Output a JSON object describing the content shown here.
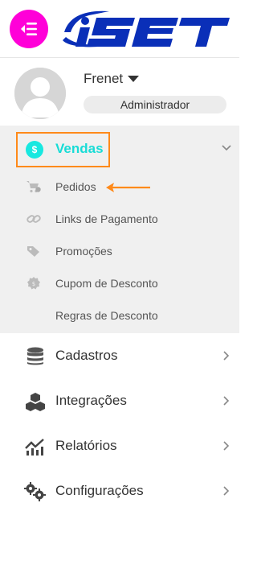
{
  "header": {
    "menu_icon": "menu-collapse-icon",
    "logo_text": "iSET",
    "brand_colors": {
      "menu_button": "#ff00d8",
      "logo_blue": "#0a2fb8"
    }
  },
  "user": {
    "name": "Frenet",
    "role": "Administrador",
    "dropdown_icon": "caret-down-icon"
  },
  "sidebar": {
    "active_color": "#18dcd6",
    "vendas": {
      "label": "Vendas",
      "icon": "dollar-circle-icon",
      "expanded": true,
      "items": [
        {
          "label": "Pedidos",
          "icon": "cart-icon"
        },
        {
          "label": "Links de Pagamento",
          "icon": "link-icon"
        },
        {
          "label": "Promoções",
          "icon": "tag-icon"
        },
        {
          "label": "Cupom de Desconto",
          "icon": "coupon-icon"
        },
        {
          "label": "Regras de Desconto",
          "icon": ""
        }
      ]
    },
    "main_items": [
      {
        "label": "Cadastros",
        "icon": "database-icon"
      },
      {
        "label": "Integrações",
        "icon": "cubes-icon"
      },
      {
        "label": "Relatórios",
        "icon": "chart-icon"
      },
      {
        "label": "Configurações",
        "icon": "gears-icon"
      }
    ]
  },
  "annotations": {
    "highlight_color": "#ff8a1a"
  }
}
